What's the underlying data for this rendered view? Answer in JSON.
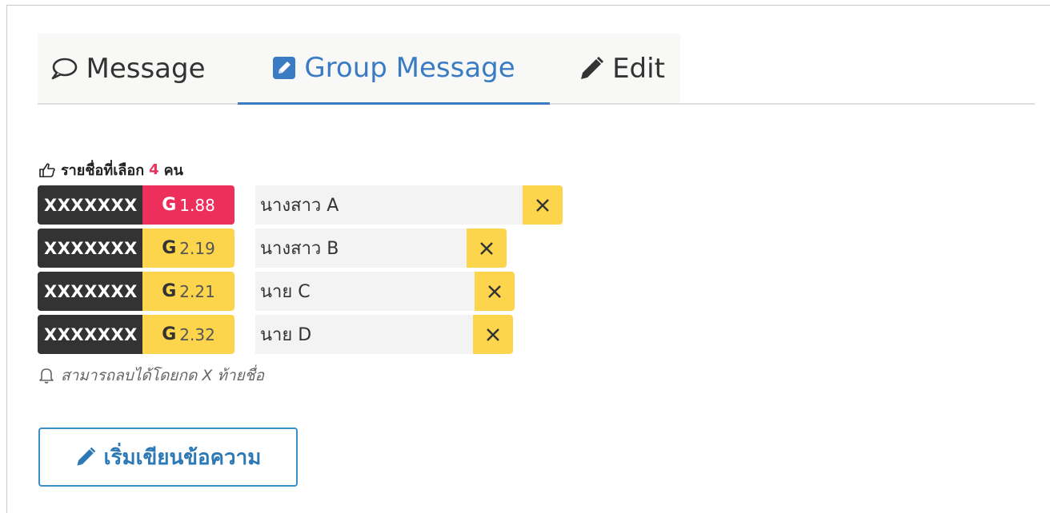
{
  "tabs": [
    {
      "label": "Message",
      "icon": "speech-bubble-icon"
    },
    {
      "label": "Group Message",
      "icon": "pencil-square-icon",
      "active": true
    },
    {
      "label": "Edit",
      "icon": "pencil-icon"
    }
  ],
  "selection": {
    "prefix": "รายชื่อที่เลือก",
    "count": "4",
    "suffix": "คน",
    "icon": "hand-pointing-icon"
  },
  "students": [
    {
      "id": "XXXXXXX",
      "grade_letter": "G",
      "gpa": "1.88",
      "name": "นางสาว A",
      "grade_color": "#ec2f5b"
    },
    {
      "id": "XXXXXXX",
      "grade_letter": "G",
      "gpa": "2.19",
      "name": "นางสาว B",
      "grade_color": "#fdd54d"
    },
    {
      "id": "XXXXXXX",
      "grade_letter": "G",
      "gpa": "2.21",
      "name": "นาย C",
      "grade_color": "#fdd54d"
    },
    {
      "id": "XXXXXXX",
      "grade_letter": "G",
      "gpa": "2.32",
      "name": "นาย D",
      "grade_color": "#fdd54d"
    }
  ],
  "hint": {
    "text": "สามารถลบได้โดยกด X ท้ายชื่อ",
    "icon": "bell-icon"
  },
  "start_button": {
    "label": "เริ่มเขียนข้อความ",
    "icon": "pencil-icon"
  },
  "colors": {
    "accent": "#3a7bc4",
    "danger": "#ec2f5b",
    "warning": "#fdd54d",
    "dark": "#333333"
  }
}
